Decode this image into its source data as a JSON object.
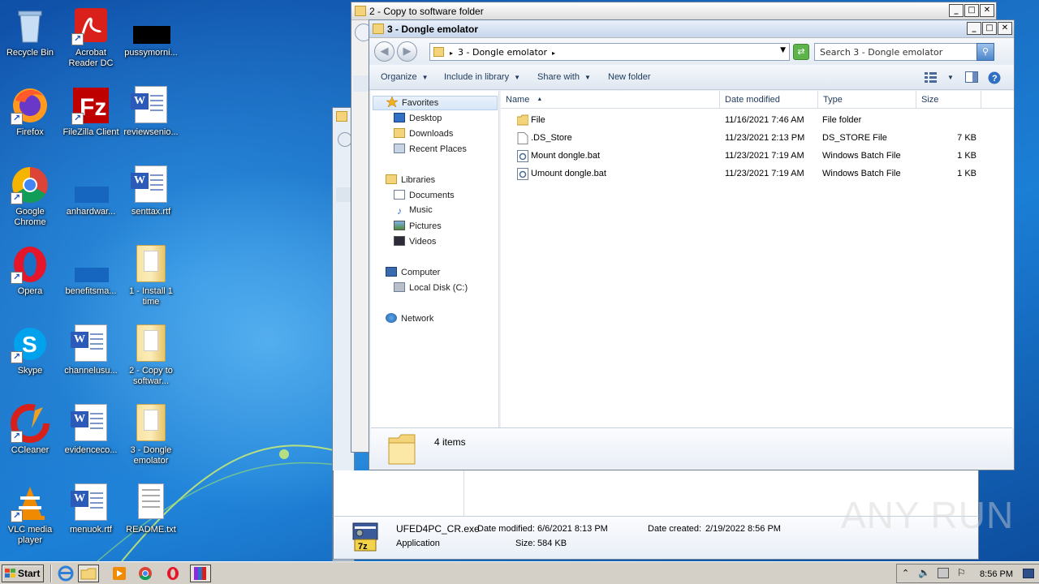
{
  "desktop": {
    "icons": [
      {
        "label": "Recycle Bin"
      },
      {
        "label": "Acrobat Reader DC"
      },
      {
        "label": "pussymorni..."
      },
      {
        "label": "Firefox"
      },
      {
        "label": "FileZilla Client"
      },
      {
        "label": "reviewsenio..."
      },
      {
        "label": "Google Chrome"
      },
      {
        "label": "anhardwar..."
      },
      {
        "label": "senttax.rtf"
      },
      {
        "label": "Opera"
      },
      {
        "label": "benefitsma..."
      },
      {
        "label": "1 - Install 1 time"
      },
      {
        "label": "Skype"
      },
      {
        "label": "channelusu..."
      },
      {
        "label": "2 - Copy to softwar..."
      },
      {
        "label": "CCleaner"
      },
      {
        "label": "evidenceco..."
      },
      {
        "label": "3 - Dongle emolator"
      },
      {
        "label": "VLC media player"
      },
      {
        "label": "menuok.rtf"
      },
      {
        "label": "README.txt"
      }
    ]
  },
  "back_window": {
    "title": "2 - Copy to software folder",
    "file": {
      "name": "UFED4PC_CR.exe",
      "date_modified_label": "Date modified:",
      "date_modified": "6/6/2021 8:13 PM",
      "date_created_label": "Date created:",
      "date_created": "2/19/2022 8:56 PM",
      "type": "Application",
      "size_label": "Size:",
      "size": "584 KB"
    }
  },
  "active_window": {
    "title": "3 - Dongle emolator",
    "address": "3 - Dongle emolator",
    "search_placeholder": "Search 3 - Dongle emolator",
    "toolbar": {
      "organize": "Organize",
      "include_in_library": "Include in library",
      "share_with": "Share with",
      "new_folder": "New folder"
    },
    "nav": {
      "favorites": "Favorites",
      "desktop": "Desktop",
      "downloads": "Downloads",
      "recent_places": "Recent Places",
      "libraries": "Libraries",
      "documents": "Documents",
      "music": "Music",
      "pictures": "Pictures",
      "videos": "Videos",
      "computer": "Computer",
      "local_disk": "Local Disk (C:)",
      "network": "Network"
    },
    "columns": {
      "name": "Name",
      "date_modified": "Date modified",
      "type": "Type",
      "size": "Size"
    },
    "files": [
      {
        "name": "File",
        "date": "11/16/2021 7:46 AM",
        "type": "File folder",
        "size": "",
        "icon": "folder-icon"
      },
      {
        "name": ".DS_Store",
        "date": "11/23/2021 2:13 PM",
        "type": "DS_STORE File",
        "size": "7 KB",
        "icon": "file-icon"
      },
      {
        "name": "Mount dongle.bat",
        "date": "11/23/2021 7:19 AM",
        "type": "Windows Batch File",
        "size": "1 KB",
        "icon": "batch-file-icon"
      },
      {
        "name": "Umount dongle.bat",
        "date": "11/23/2021 7:19 AM",
        "type": "Windows Batch File",
        "size": "1 KB",
        "icon": "batch-file-icon"
      }
    ],
    "status": "4 items"
  },
  "taskbar": {
    "start": "Start",
    "clock": "8:56 PM"
  },
  "watermark": "ANY RUN",
  "colors": {
    "desktop": "#1a70c4",
    "titlebar_active": "#c6d6ec",
    "taskbar": "#d4d0c8"
  }
}
